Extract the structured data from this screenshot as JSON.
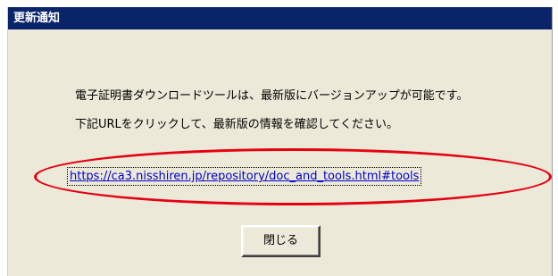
{
  "window": {
    "title": "更新通知"
  },
  "message": {
    "line1": "電子証明書ダウンロードツールは、最新版にバージョンアップが可能です。",
    "line2": "下記URLをクリックして、最新版の情報を確認してください。"
  },
  "link": {
    "text": "https://ca3.nisshiren.jp/repository/doc_and_tools.html#tools"
  },
  "buttons": {
    "close_label": "閉じる"
  },
  "colors": {
    "titlebar": "#0a246a",
    "dialog_background": "#ece9d8",
    "link": "#0000cc",
    "callout": "#e60012"
  }
}
